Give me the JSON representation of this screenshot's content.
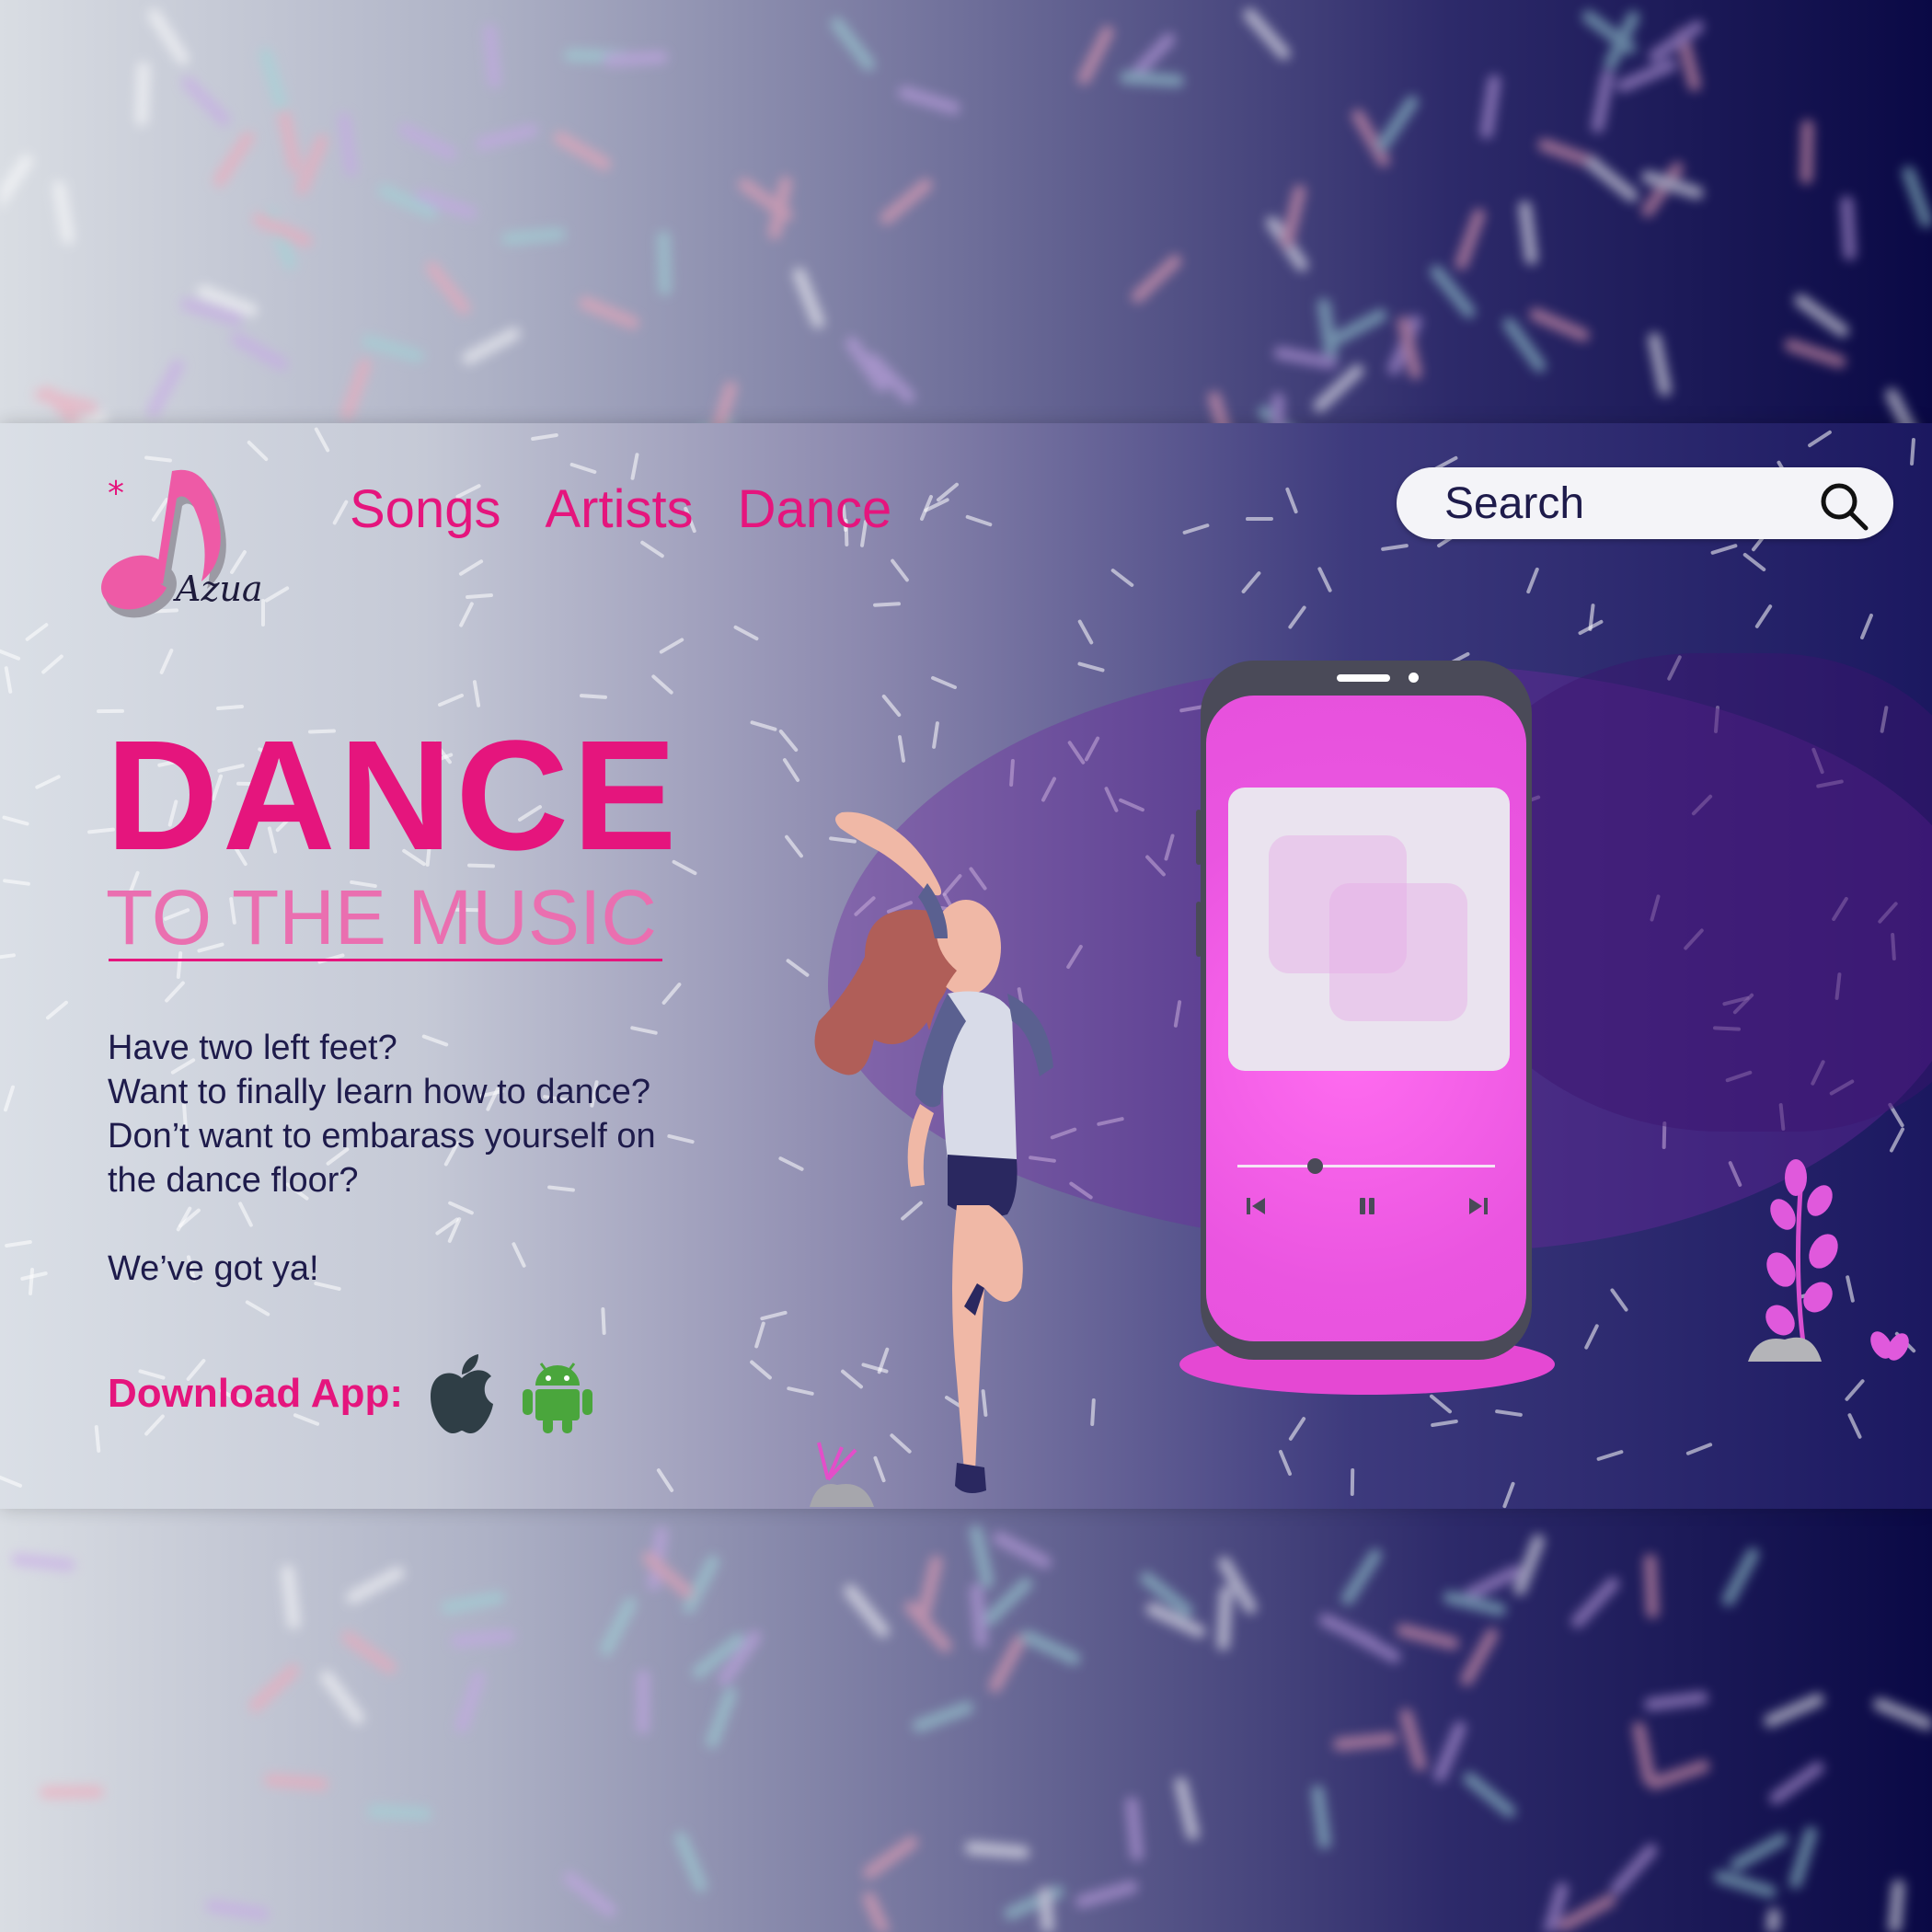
{
  "brand": {
    "name": "Azua"
  },
  "nav": {
    "items": [
      "Songs",
      "Artists",
      "Dance"
    ]
  },
  "search": {
    "placeholder": "Search"
  },
  "hero": {
    "title": "DANCE",
    "subtitle": "TO THE MUSIC",
    "lines": [
      "Have two left feet?",
      "Want to finally learn how to dance?",
      "Don’t want to embarass yourself on",
      "the dance floor?"
    ],
    "tagline": "We’ve got ya!"
  },
  "download": {
    "label": "Download App:",
    "stores": [
      "apple-icon",
      "android-icon"
    ]
  },
  "player": {
    "progress": 0.3,
    "controls": [
      "previous-icon",
      "pause-icon",
      "next-icon"
    ]
  },
  "colors": {
    "accent": "#e5157d",
    "accent_light": "#ea6fb0",
    "phone_screen": "#ea55e0",
    "text_dark": "#1e1b4b"
  }
}
